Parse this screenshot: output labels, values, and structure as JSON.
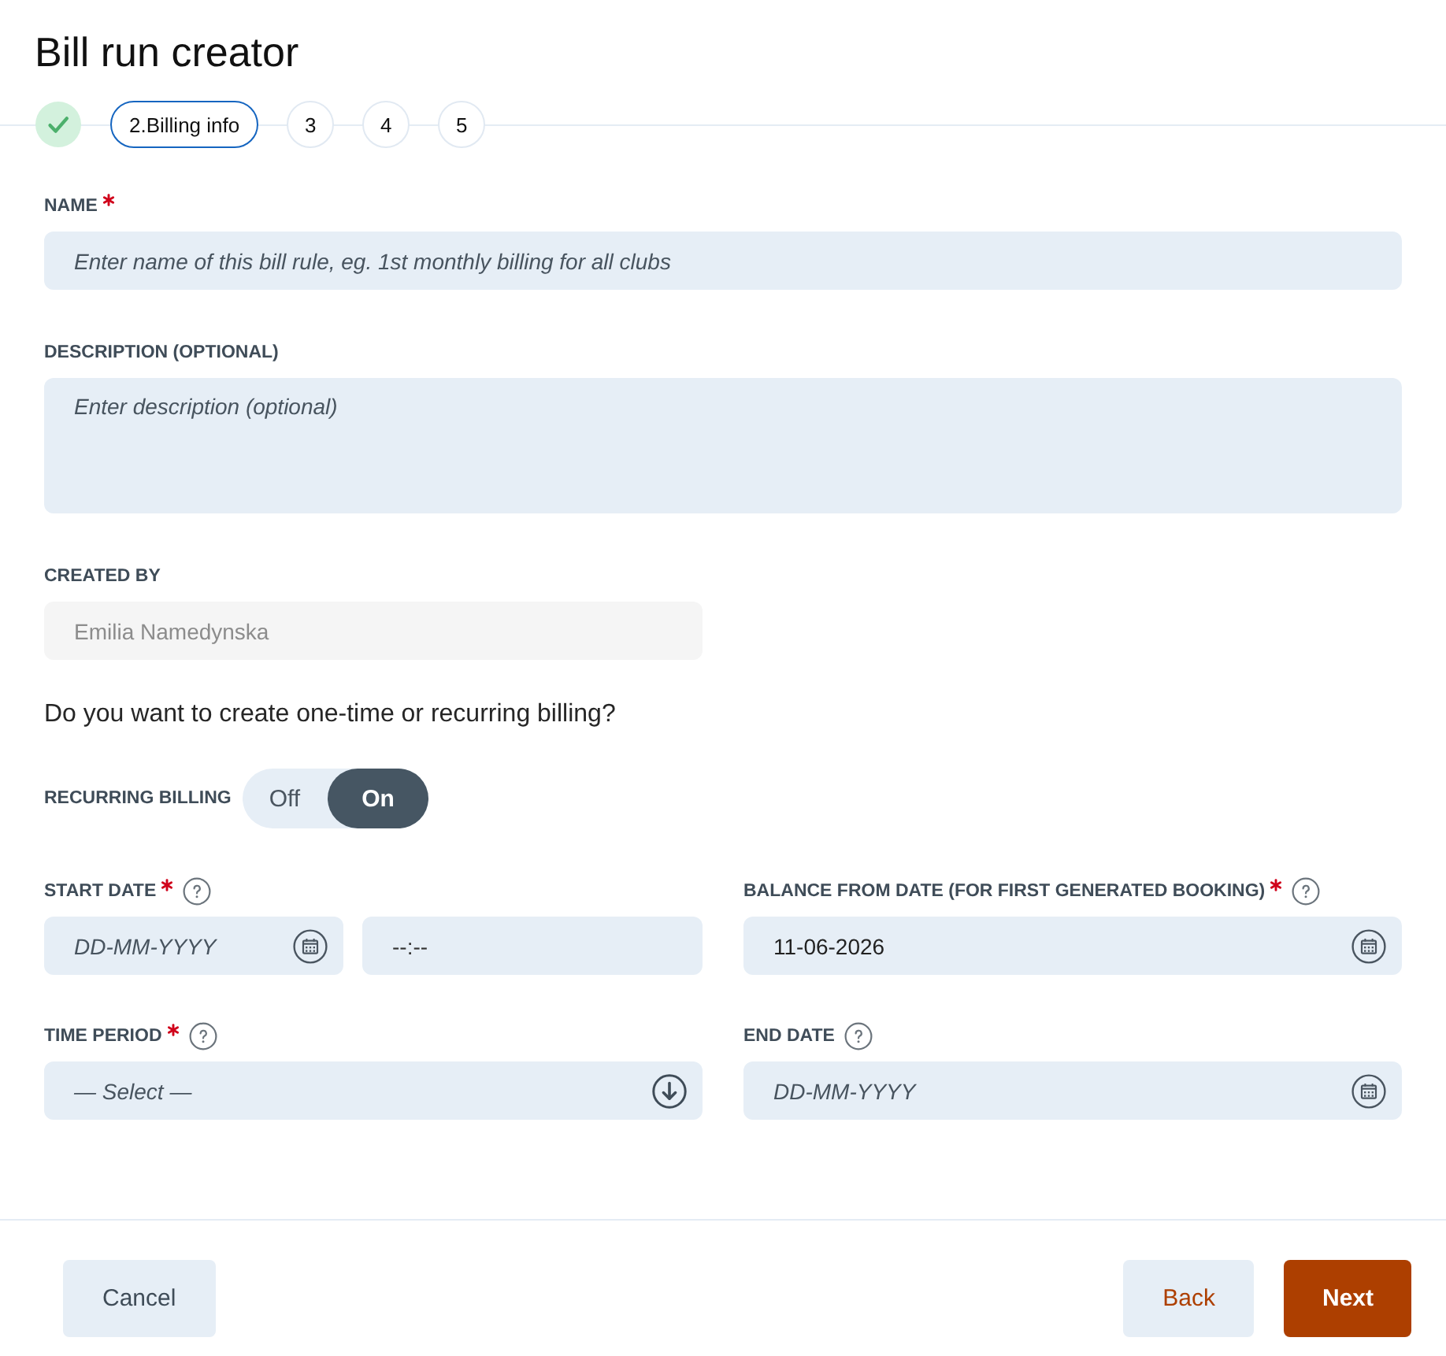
{
  "title": "Bill run creator",
  "steps": [
    {
      "done": true,
      "selected": false
    },
    {
      "label": "2.Billing info",
      "done": false,
      "selected": true
    },
    {
      "label": "3",
      "done": false,
      "selected": false
    },
    {
      "label": "4",
      "done": false,
      "selected": false
    },
    {
      "label": "5",
      "done": false,
      "selected": false
    }
  ],
  "fields": [
    {
      "kind": "text",
      "label": "NAME",
      "required": true,
      "placeholder": "Enter name of this bill rule, eg. 1st monthly billing for all clubs",
      "disabled": false
    },
    {
      "kind": "textarea",
      "label": "DESCRIPTION (OPTIONAL)",
      "required": false,
      "placeholder": "Enter description (optional)",
      "disabled": false
    },
    {
      "kind": "text",
      "label": "CREATED BY",
      "required": false,
      "value": "Emilia Namedynska",
      "disabled": true
    }
  ],
  "question": "Do you want to create one-time or recurring billing?",
  "recurring_billing": {
    "label": "RECURRING BILLING",
    "options": [
      {
        "label": "Off",
        "selected": false
      },
      {
        "label": "On",
        "selected": true
      }
    ]
  },
  "schedule": [
    {
      "kind": "datetime",
      "label": "START DATE",
      "required": true,
      "help": true,
      "date_placeholder": "DD-MM-YYYY",
      "time_placeholder": "--:--"
    },
    {
      "kind": "date",
      "label": "BALANCE FROM DATE (FOR FIRST GENERATED BOOKING)",
      "required": true,
      "help": true,
      "value": "11-06-2026"
    },
    {
      "kind": "select",
      "label": "TIME PERIOD",
      "required": true,
      "help": true,
      "placeholder": "— Select —"
    },
    {
      "kind": "date",
      "label": "END DATE",
      "required": false,
      "help": true,
      "placeholder": "DD-MM-YYYY"
    }
  ],
  "footer": {
    "left_buttons": [
      {
        "label": "Cancel",
        "kind": "neutral"
      }
    ],
    "right_buttons": [
      {
        "label": "Back",
        "kind": "subtle"
      },
      {
        "label": "Next",
        "kind": "primary"
      }
    ]
  }
}
